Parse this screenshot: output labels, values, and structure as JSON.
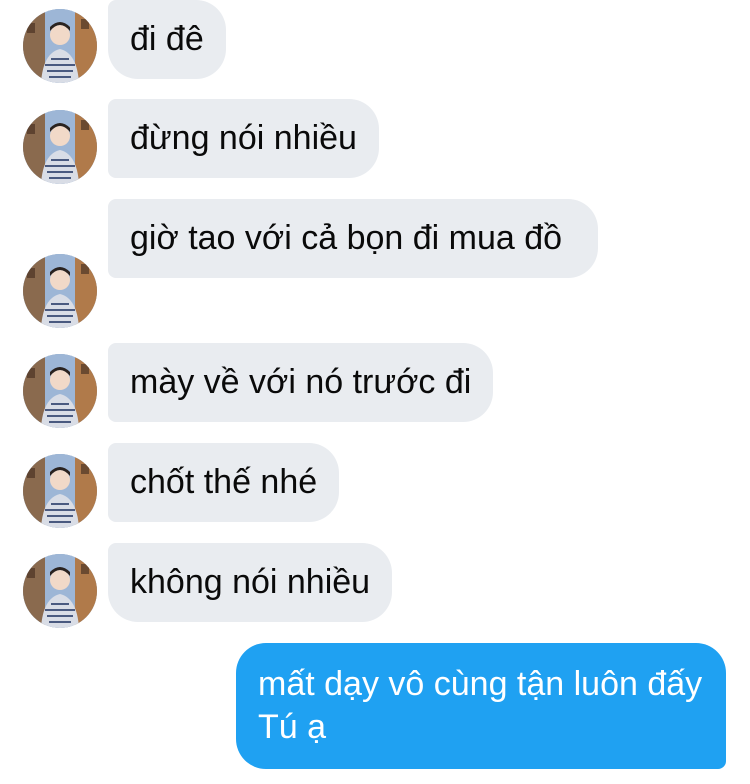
{
  "conversation": {
    "messages": [
      {
        "sender": "other",
        "text": "đi đê"
      },
      {
        "sender": "other",
        "text": "đừng nói nhiều"
      },
      {
        "sender": "other",
        "text": "giờ tao với cả bọn đi mua đồ"
      },
      {
        "sender": "other",
        "text": "mày về với nó trước đi"
      },
      {
        "sender": "other",
        "text": "chốt thế nhé"
      },
      {
        "sender": "other",
        "text": "không nói nhiều"
      },
      {
        "sender": "me",
        "text": "mất dạy vô cùng tận luôn đấy Tú ạ"
      }
    ]
  },
  "colors": {
    "received_bubble": "#e9ecf0",
    "sent_bubble": "#1fa1f2",
    "received_text": "#0a0a0a",
    "sent_text": "#ffffff"
  },
  "icons": {
    "avatar": "avatar-photo"
  }
}
